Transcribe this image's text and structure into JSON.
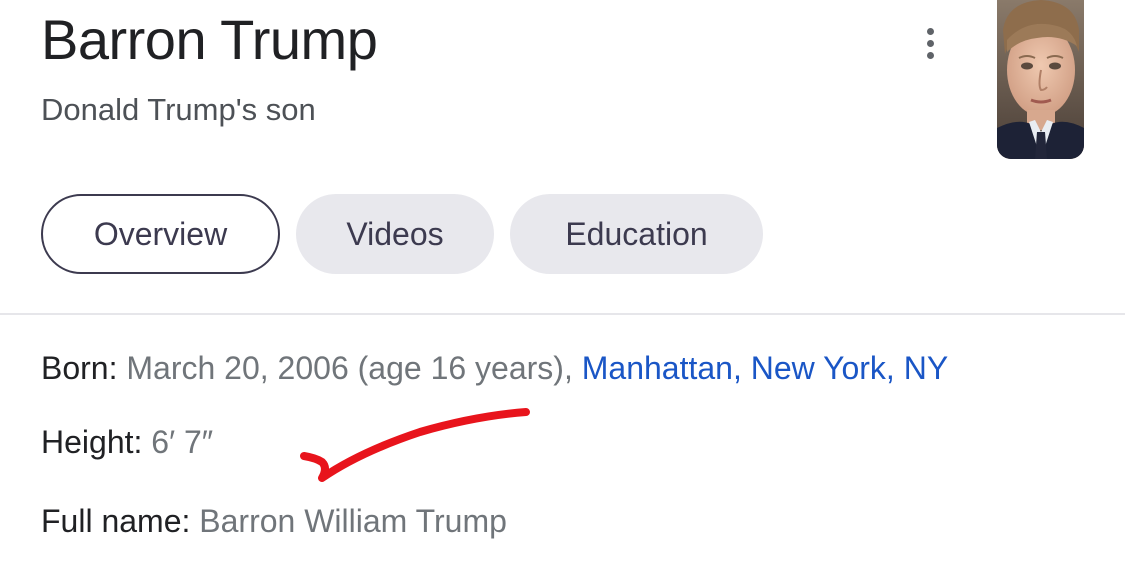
{
  "header": {
    "title": "Barron Trump",
    "subtitle": "Donald Trump's son",
    "more_icon": "more-vert-icon"
  },
  "thumbnail": {
    "description_icon": "portrait-photo"
  },
  "tabs": [
    {
      "label": "Overview",
      "active": true
    },
    {
      "label": "Videos",
      "active": false
    },
    {
      "label": "Education",
      "active": false
    }
  ],
  "facts": {
    "born": {
      "label": "Born:",
      "value": "March 20, 2006 (age 16 years),",
      "link": "Manhattan, New York, NY"
    },
    "height": {
      "label": "Height:",
      "value": "6′ 7″"
    },
    "full_name": {
      "label": "Full name:",
      "value": "Barron William Trump"
    }
  },
  "annotation": {
    "type": "checkmark",
    "color": "#e8141c"
  },
  "colors": {
    "link": "#1a56c6",
    "value": "#70757a",
    "tab_bg": "#e8e8ed",
    "tab_text": "#3c3a4f"
  }
}
